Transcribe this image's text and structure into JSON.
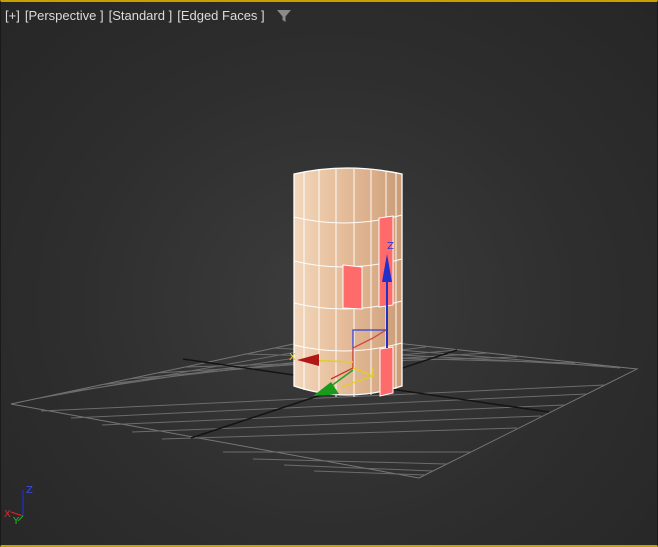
{
  "viewport": {
    "labels": {
      "plus": "[+]",
      "view": "[Perspective ]",
      "shading": "[Standard ]",
      "display": "[Edged Faces ]"
    },
    "filter_icon": "funnel-icon"
  },
  "gizmo": {
    "x_label": "X",
    "z_label": "Z"
  },
  "axis_tripod": {
    "x_label": "X",
    "y_label": "Y",
    "z_label": "Z"
  },
  "colors": {
    "active_border": "#c8a000",
    "cylinder_face": "#e8c2a0",
    "selected_face": "#ff6a6a",
    "grid_line": "#6e6e6e",
    "axis_x": "#cc2020",
    "axis_y": "#20a020",
    "axis_z": "#2030c8"
  }
}
